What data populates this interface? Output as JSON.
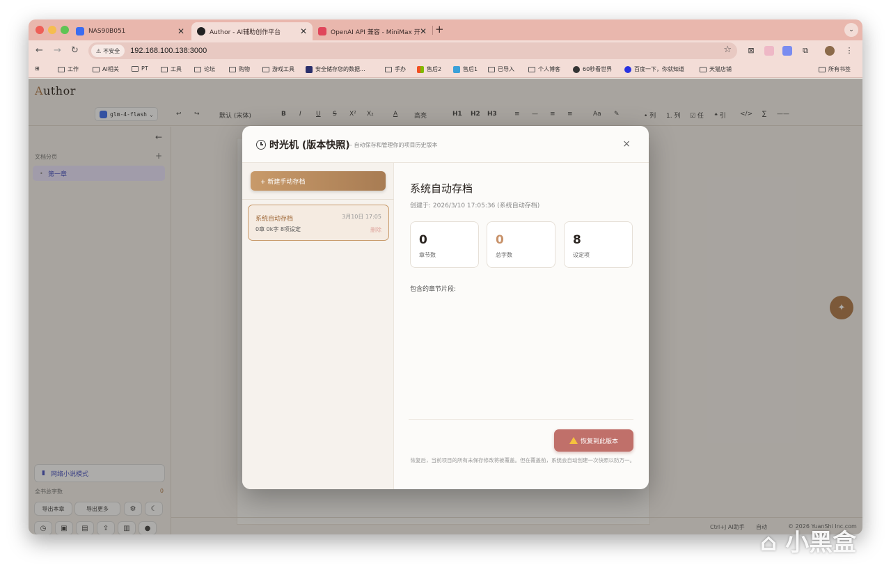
{
  "browser": {
    "tabs": [
      {
        "title": "NAS90B051",
        "favicon_color": "#3b6cf0"
      },
      {
        "title": "Author - AI辅助创作平台",
        "favicon_color": "#222222"
      },
      {
        "title": "OpenAI API 兼容 - MiniMax 开",
        "favicon_color": "#e0455a"
      }
    ],
    "address": {
      "security_label": "不安全",
      "url": "192.168.100.138:3000"
    },
    "bookmarks": [
      "工作",
      "AI相关",
      "PT",
      "工具",
      "论坛",
      "购物",
      "游戏工具",
      "安全储存您的数据...",
      "手办",
      "售后2",
      "售后1",
      "已导入",
      "个人博客",
      "60秒看世界",
      "百度一下，你就知道",
      "天猫店铺"
    ],
    "bookmarks_all": "所有书签"
  },
  "app": {
    "brand_first": "A",
    "brand_rest": "uthor",
    "toolbar": {
      "model": "glm-4-flash",
      "font": "默认 (宋体)",
      "highlight": "高亮",
      "buttons": [
        "B",
        "I",
        "U",
        "S",
        "X²",
        "X₂",
        "A",
        "H1",
        "H2",
        "H3",
        "Aa",
        "• 列",
        "1. 列",
        "☑ 任",
        "❝ 引",
        "</>",
        "∑",
        "——"
      ]
    },
    "sidebar": {
      "section_title": "文档分页",
      "chapter": "第一章",
      "mode_button": "网络小说模式",
      "word_count_label": "全书总字数",
      "word_count_value": "0",
      "export_chapter": "导出本章",
      "export_more": "导出更多"
    },
    "status": {
      "shortcut": "Ctrl+J AI助手",
      "autosave": "自动",
      "copyright": "© 2026 YuanShi Inc.com"
    }
  },
  "modal": {
    "title": "时光机 (版本快照)",
    "subtitle": "— 自动保存和管理你的项目历史版本",
    "close": "×",
    "new_snapshot": "+ 新建手动存档",
    "snapshots": [
      {
        "name": "系统自动存档",
        "date": "3月10日 17:05",
        "meta": "0章   0k字   8项设定",
        "delete": "删除"
      }
    ],
    "detail": {
      "title": "系统自动存档",
      "created": "创建于: 2026/3/10 17:05:36 (系统自动存档)",
      "stats": [
        {
          "value": "0",
          "label": "章节数",
          "color": "#2a2420"
        },
        {
          "value": "0",
          "label": "总字数",
          "color": "#c8926a"
        },
        {
          "value": "8",
          "label": "设定项",
          "color": "#2a2420"
        }
      ],
      "segments_label": "包含的章节片段:",
      "restore_button": "恢复到此版本",
      "restore_note": "恢复后，当前项目的所有未保存修改将被覆盖。但在覆盖前，系统会自动创建一次快照以防万一。"
    }
  },
  "watermark": "小黑盒"
}
